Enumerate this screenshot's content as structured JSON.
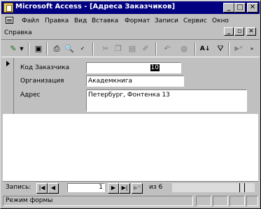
{
  "window": {
    "title": "Microsoft Access - [Адреса Заказчиков]",
    "buttons": {
      "minimize": "_",
      "restore": "□",
      "close": "✕"
    }
  },
  "menu": {
    "items": [
      "Файл",
      "Правка",
      "Вид",
      "Вставка",
      "Формат",
      "Записи",
      "Сервис",
      "Окно",
      "Справка"
    ],
    "mdi_buttons": {
      "minimize": "_",
      "restore": "▫",
      "close": "✕"
    }
  },
  "toolbar": {
    "icons": [
      "view-design-icon",
      "dropdown-icon",
      "save-icon",
      "print-icon",
      "print-preview-icon",
      "spelling-icon",
      "cut-icon",
      "copy-icon",
      "paste-icon",
      "format-painter-icon",
      "undo-icon",
      "web-icon",
      "sort-asc-icon",
      "filter-icon",
      "new-record-icon"
    ]
  },
  "form": {
    "fields": [
      {
        "label": "Код Заказчика",
        "value": "10"
      },
      {
        "label": "Организация",
        "value": "Академкнига"
      },
      {
        "label": "Адрес",
        "value": "Петербург, Фонтенка 13"
      }
    ]
  },
  "navigation": {
    "label": "Запись:",
    "current": "1",
    "of_text": "из 6",
    "buttons": {
      "first": "|◀",
      "prev": "◀",
      "next": "▶",
      "last": "▶|",
      "new": "▶*"
    }
  },
  "status": {
    "text": "Режим формы"
  }
}
